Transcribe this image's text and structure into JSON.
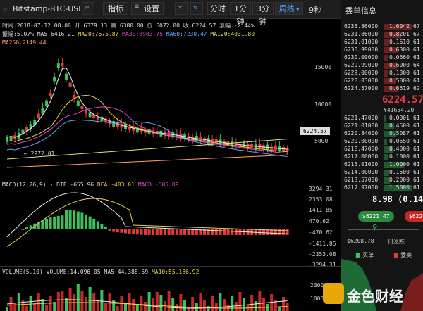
{
  "toolbar": {
    "symbol": "Bitstamp-BTC-USD",
    "indicator_label": "指标",
    "settings_label": "设置",
    "tf_1": "分时",
    "tf_2": "1分钟",
    "tf_3": "3分钟",
    "tf_4": "周线",
    "countdown": "9秒",
    "accent": "#4da6ff"
  },
  "info_line1": "时间:2018-07-12 08:00  开:6379.13 高:6380.00 低:6072.00 收:6224.57 涨幅:-2.44%",
  "info_line2a": "振幅:5.07%",
  "ma": {
    "ma5": "MA5:6416.21",
    "ma20": "MA20:7675.87",
    "ma30": "MA30:8983.75",
    "ma60": "MA60:7230.47",
    "ma120": "MA120:4031.80",
    "ma250": "MA250:2149.44"
  },
  "price_axis": [
    "15000",
    "10000",
    "5000"
  ],
  "current_price_tag": "6224.57",
  "low_marker": "2972.01",
  "macd": {
    "title": "MACD(12,26,9)",
    "dif": "DIF:-655.96",
    "dea": "DEA:-403.01",
    "macd": "MACD:-505.89",
    "axis": [
      "3294.31",
      "2353.08",
      "1411.85",
      "470.62",
      "-470.62",
      "-1411.85",
      "-2353.08",
      "-3294.31"
    ]
  },
  "volume": {
    "title": "VOLUME(5,10)",
    "volume": "VOLUME:14,096.05",
    "ma5": "MA5:44,388.59",
    "ma10": "MA10:55,186.92",
    "axis": [
      "20000",
      "10000"
    ]
  },
  "right_panel": {
    "title": "委单信息",
    "asks": [
      {
        "price": "6233.86000",
        "qty": "1.6042",
        "tail": "67"
      },
      {
        "price": "6231.86000",
        "qty": "0.8201",
        "tail": "67"
      },
      {
        "price": "6231.01000",
        "qty": "0.1610",
        "tail": "61"
      },
      {
        "price": "6230.99000",
        "qty": "0.6300",
        "tail": "61"
      },
      {
        "price": "6230.00000",
        "qty": "0.0660",
        "tail": "61"
      },
      {
        "price": "6229.99000",
        "qty": "0.6000",
        "tail": "64"
      },
      {
        "price": "6229.00000",
        "qty": "0.1300",
        "tail": "61"
      },
      {
        "price": "6228.03000",
        "qty": "0.5000",
        "tail": "61"
      },
      {
        "price": "6224.57000",
        "qty": "0.6619",
        "tail": "62"
      }
    ],
    "last_price": "6224.57",
    "last_price_sub": "¥41654.20",
    "bids": [
      {
        "price": "6221.47000",
        "qty": "0.0001",
        "tail": "61"
      },
      {
        "price": "6221.01000",
        "qty": "0.4500",
        "tail": "61"
      },
      {
        "price": "6220.84000",
        "qty": "0.5087",
        "tail": "61"
      },
      {
        "price": "6220.00000",
        "qty": "0.0550",
        "tail": "61"
      },
      {
        "price": "6218.47000",
        "qty": "0.4000",
        "tail": "61"
      },
      {
        "price": "6217.00000",
        "qty": "0.1000",
        "tail": "61"
      },
      {
        "price": "6215.01000",
        "qty": "1.0000",
        "tail": "61"
      },
      {
        "price": "6214.00000",
        "qty": "0.1500",
        "tail": "61"
      },
      {
        "price": "6213.57000",
        "qty": "0.2000",
        "tail": "61"
      },
      {
        "price": "6212.97000",
        "qty": "1.5000",
        "tail": "61"
      }
    ],
    "change": "8.98",
    "change_pct": "(0.14%)",
    "buy_price": "$6221.47",
    "sell_price": "$622",
    "low_price": "$6208.78",
    "range_label": "日涨跌",
    "buy_label": "买单",
    "sell_label": "委卖"
  },
  "watermark": "金色财经"
}
